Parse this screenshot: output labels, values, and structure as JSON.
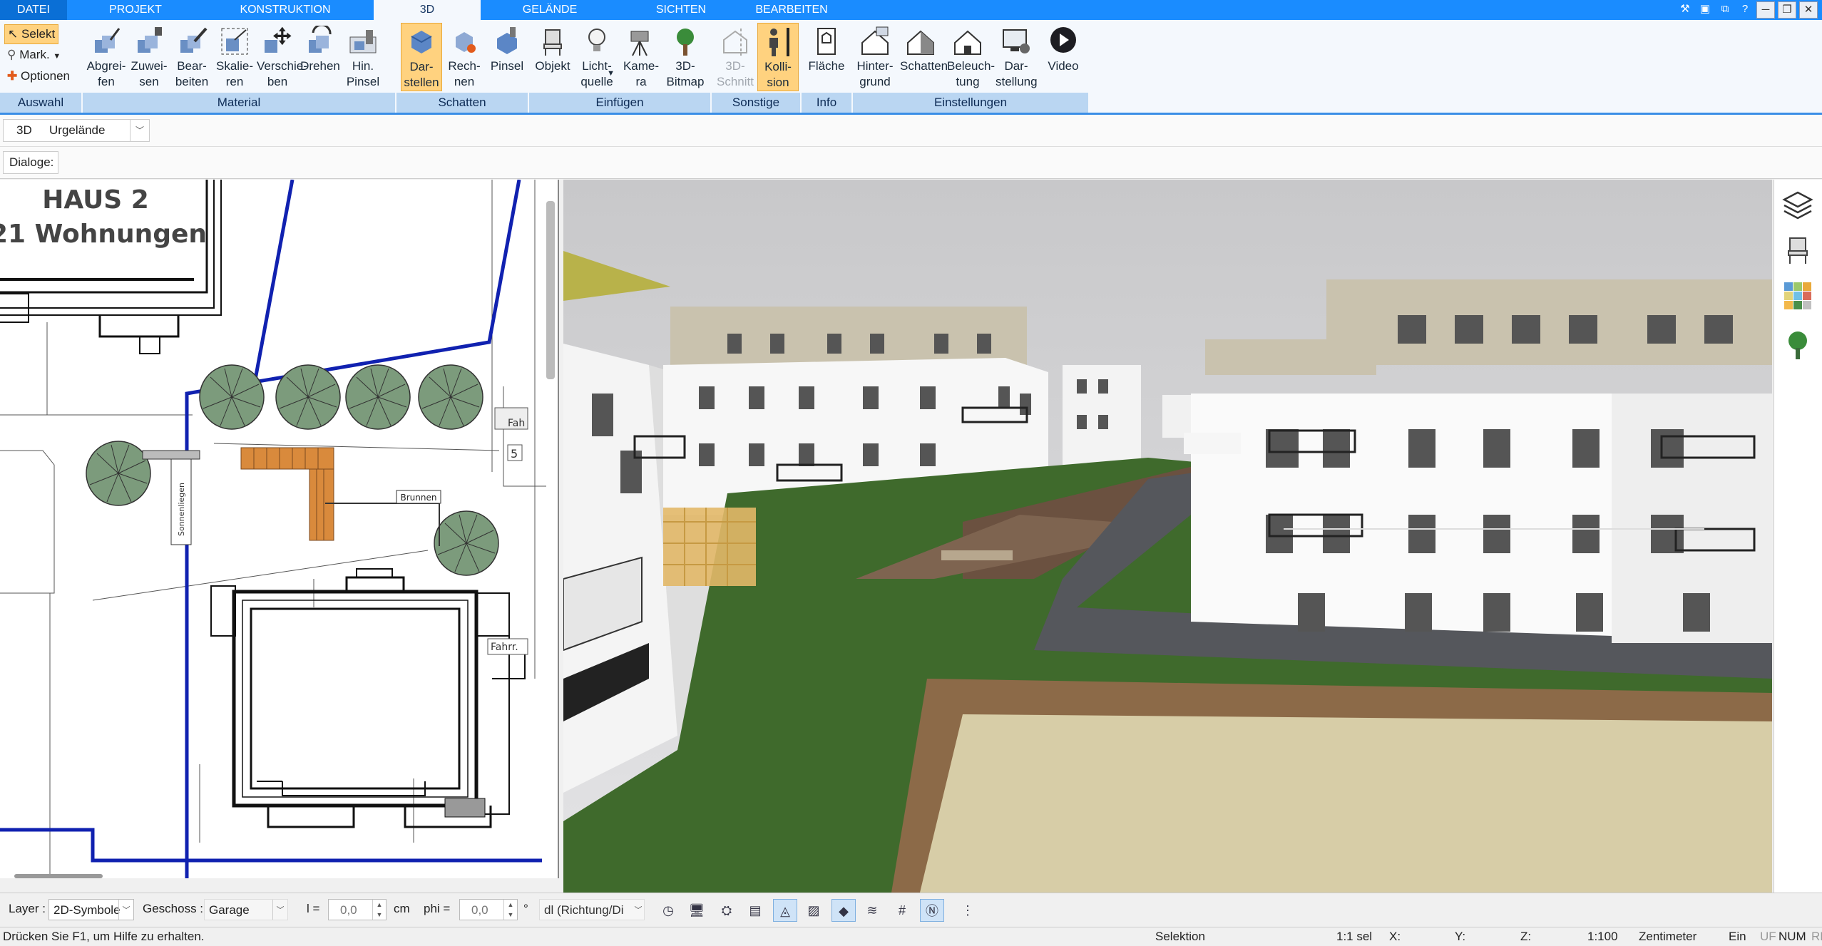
{
  "menu": {
    "tabs": [
      "DATEI",
      "PROJEKT",
      "KONSTRUKTION",
      "3D",
      "GELÄNDE",
      "SICHTEN",
      "BEARBEITEN"
    ],
    "active_tab": "3D"
  },
  "window_controls": [
    "─",
    "❐",
    "✕"
  ],
  "ribbon": {
    "auswahl": {
      "label": "Auswahl",
      "selekt": "Selekt",
      "mark": "Mark.",
      "optionen": "Optionen"
    },
    "material": {
      "label": "Material",
      "buttons": [
        "Abgrei-\nfen",
        "Zuwei-\nsen",
        "Bear-\nbeiten",
        "Skalie-\nren",
        "Verschie-\nben",
        "Drehen",
        "Hin.\nPinsel"
      ]
    },
    "schatten": {
      "label": "Schatten",
      "buttons": [
        "Dar-\nstellen",
        "Rech-\nnen",
        "Pinsel"
      ]
    },
    "einfuegen": {
      "label": "Einfügen",
      "buttons": [
        "Objekt",
        "Licht-\nquelle",
        "Kame-\nra",
        "3D-\nBitmap"
      ]
    },
    "sonstige": {
      "label": "Sonstige",
      "buttons": [
        "3D-\nSchnitt",
        "Kolli-\nsion"
      ]
    },
    "info": {
      "label": "Info",
      "buttons": [
        "Fläche"
      ]
    },
    "einstellungen": {
      "label": "Einstellungen",
      "buttons": [
        "Hinter-\ngrund",
        "Schatten",
        "Beleuch-\ntung",
        "Dar-\nstellung",
        "Video"
      ]
    }
  },
  "toolbar": {
    "mode_label": "3D",
    "terrain_value": "Urgelände",
    "dialoge_label": "Dialoge:"
  },
  "plan": {
    "title_line1": "HAUS 2",
    "title_line2": "21 Wohnungen",
    "label_brunnen": "Brunnen",
    "label_fahr": "Fahrr.",
    "label_fah": "Fah",
    "label_5": "5",
    "label_sonnenliege": "Sonnenliegen"
  },
  "bottom": {
    "layer_label": "Layer :",
    "layer_value": "2D-Symbole",
    "geschoss_label": "Geschoss :",
    "geschoss_value": "Garage",
    "l_label": "l =",
    "l_value": "0,0",
    "unit_cm": "cm",
    "phi_label": "phi =",
    "phi_value": "0,0",
    "unit_deg": "°",
    "dl_value": "dl (Richtung/Di"
  },
  "status": {
    "help": "Drücken Sie F1, um Hilfe zu erhalten.",
    "mode": "Selektion",
    "sel": "1:1 sel",
    "x": "X:",
    "y": "Y:",
    "z": "Z:",
    "scale": "1:100",
    "unit": "Zentimeter",
    "ein": "Ein",
    "uf": "UF",
    "num": "NUM",
    "rf": "RF"
  },
  "colors": {
    "menubar": "#1a8cff",
    "ribbon_group_label": "#bad6f2",
    "selected_button": "#ffd27f",
    "grass": "#3f6a2c",
    "path": "#55575c",
    "building": "#f2f2f2",
    "boundary_line": "#1021b0"
  }
}
